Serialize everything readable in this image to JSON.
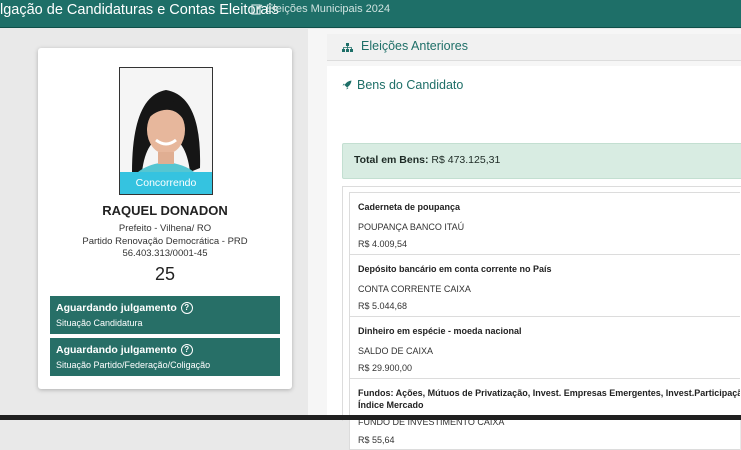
{
  "header": {
    "title": "lgação de Candidaturas e Contas Eleitorais",
    "subtitle": "Eleições Municipais 2024"
  },
  "candidate": {
    "status_badge": "Concorrendo",
    "name": "RAQUEL DONADON",
    "office": "Prefeito - Vilhena/ RO",
    "party": "Partido Renovação Democrática - PRD",
    "cnpj": "56.403.313/0001-45",
    "number": "25",
    "statuses": [
      {
        "title": "Aguardando julgamento",
        "subtitle": "Situação Candidatura"
      },
      {
        "title": "Aguardando julgamento",
        "subtitle": "Situação Partido/Federação/Coligação"
      }
    ]
  },
  "previous_elections": {
    "label": "Eleições Anteriores"
  },
  "assets": {
    "title": "Bens do Candidato",
    "total_label": "Total em Bens:",
    "total_value": "R$ 473.125,31",
    "items": [
      {
        "type": "Caderneta de poupança",
        "description": "POUPANÇA BANCO ITAÚ",
        "value": "R$ 4.009,54"
      },
      {
        "type": "Depósito bancário em conta corrente no País",
        "description": "CONTA CORRENTE CAIXA",
        "value": "R$ 5.044,68"
      },
      {
        "type": "Dinheiro em espécie - moeda nacional",
        "description": "SALDO DE CAIXA",
        "value": "R$ 29.900,00"
      },
      {
        "type": "Fundos: Ações, Mútuos de Privatização, Invest. Empresas Emergentes, Invest.Participação e In",
        "type_line2": "Índice Mercado",
        "description": "FUNDO DE INVESTIMENTO CAIXA",
        "value": "R$ 55,64"
      }
    ]
  },
  "colors": {
    "primary": "#1e6f68",
    "badge": "#35c3e0",
    "status_box": "#276f67",
    "total_bg": "#d8ece2"
  }
}
